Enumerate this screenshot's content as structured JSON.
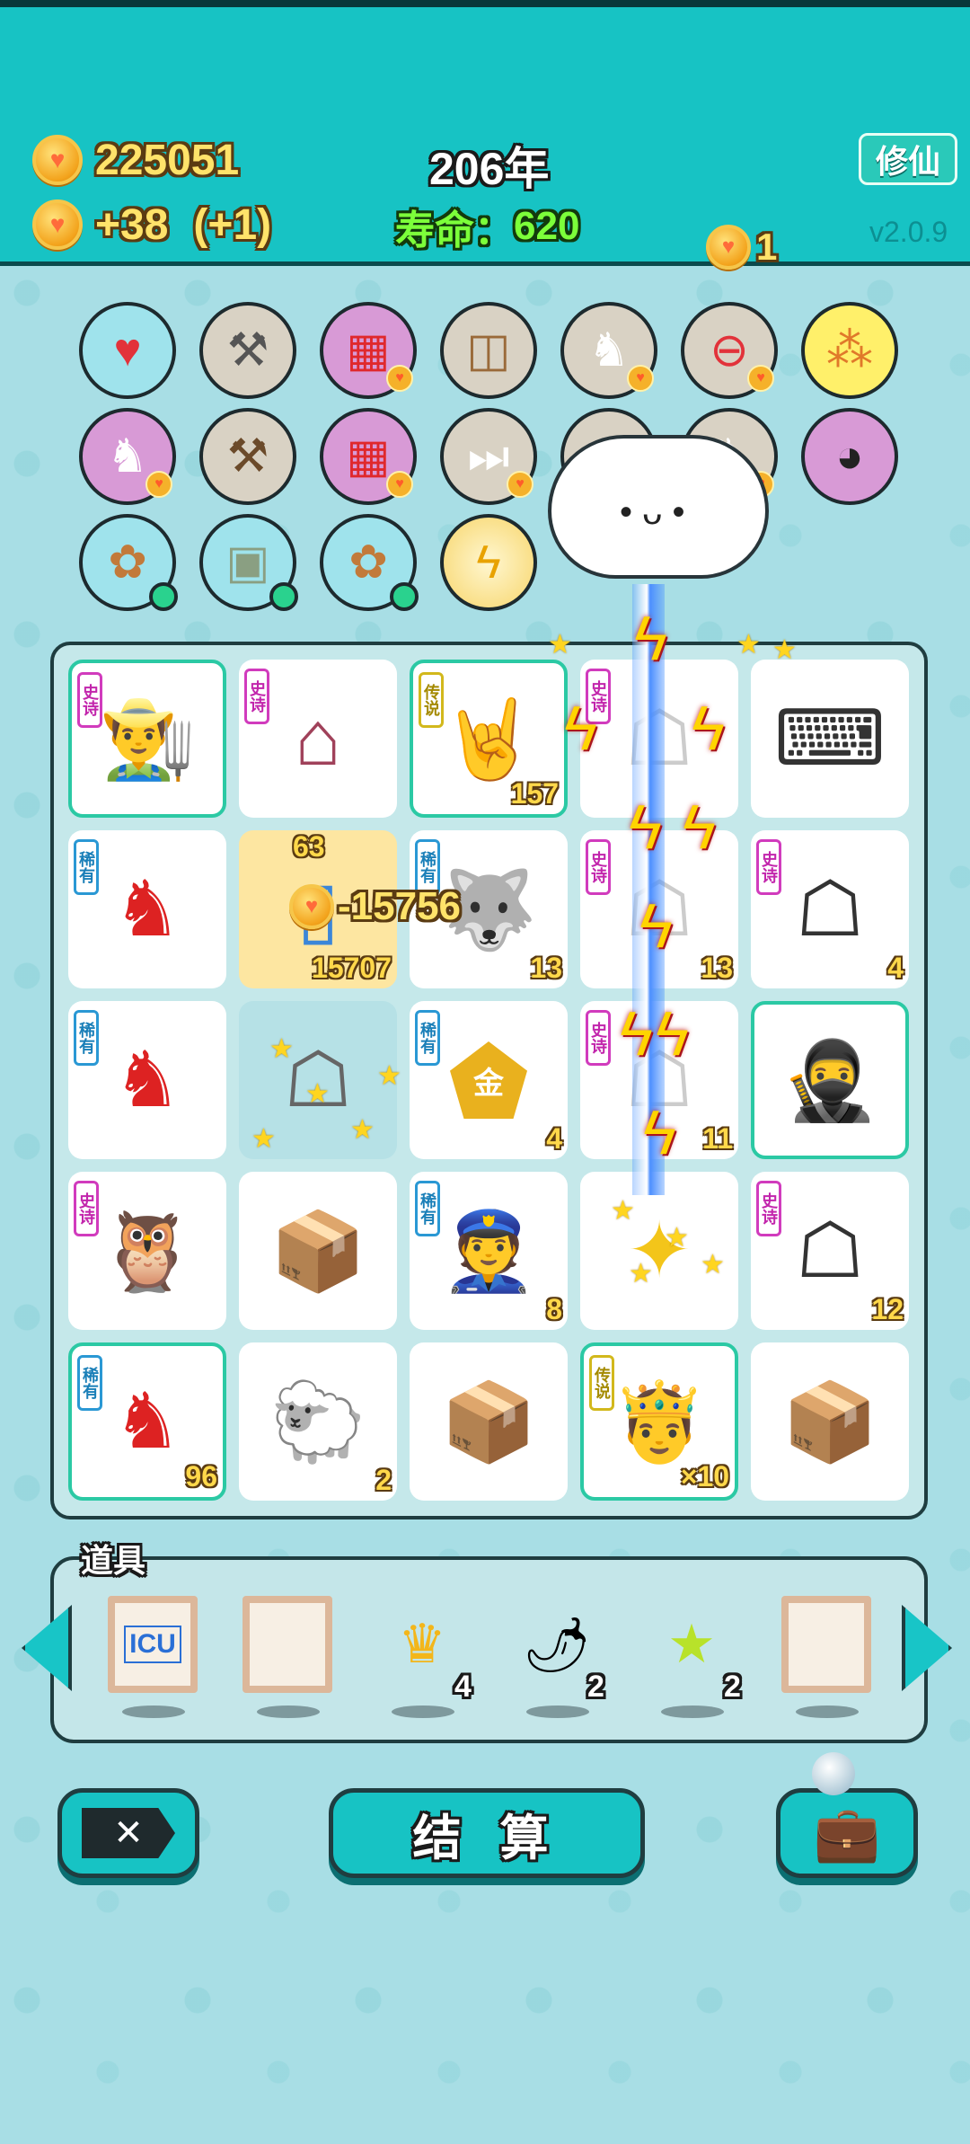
{
  "header": {
    "coins": "225051",
    "income": "+38",
    "income_bonus": "(+1)",
    "year": "206年",
    "lifespan_label": "寿命：",
    "lifespan_value": "620",
    "xiuxian_button": "修仙",
    "version": "v2.0.9",
    "coin_popup": "1"
  },
  "relics": [
    {
      "icon": "heart-bag-icon"
    },
    {
      "icon": "screwdriver-icon"
    },
    {
      "icon": "fries-icon"
    },
    {
      "icon": "dog-food-icon"
    },
    {
      "icon": "bunny-icon"
    },
    {
      "icon": "minus-icon"
    },
    {
      "icon": "basketballs-icon"
    },
    {
      "icon": "bunny-icon"
    },
    {
      "icon": "hammer-icon"
    },
    {
      "icon": "fries-icon"
    },
    {
      "icon": "skip-icon"
    },
    {
      "icon": "chick-icon"
    },
    {
      "icon": "bunny-icon"
    },
    {
      "icon": "panda-icon"
    },
    {
      "icon": "flower-pot-icon"
    },
    {
      "icon": "money-bag-icon"
    },
    {
      "icon": "flower-pot-icon"
    },
    {
      "icon": "lightning-icon"
    }
  ],
  "board": {
    "cells": [
      {
        "tag": "史诗",
        "icon": "farmer-icon",
        "count": ""
      },
      {
        "tag": "史诗",
        "icon": "bunny-house-icon",
        "count": ""
      },
      {
        "tag": "传说",
        "icon": "rock-hand-icon",
        "count": "157"
      },
      {
        "tag": "史诗",
        "icon": "ghost-icon",
        "count": ""
      },
      {
        "tag": "",
        "icon": "keyboard-icon",
        "count": ""
      },
      {
        "tag": "稀有",
        "icon": "bunny-icon",
        "count": ""
      },
      {
        "tag": "",
        "icon": "fridge-icon",
        "count": "15707"
      },
      {
        "tag": "稀有",
        "icon": "husky-icon",
        "count": "13"
      },
      {
        "tag": "史诗",
        "icon": "ghost-icon",
        "count": "13"
      },
      {
        "tag": "史诗",
        "icon": "ghost-icon",
        "count": "4"
      },
      {
        "tag": "稀有",
        "icon": "bunny-icon",
        "count": ""
      },
      {
        "tag": "",
        "icon": "ghost-icon",
        "count": ""
      },
      {
        "tag": "稀有",
        "icon": "gold-badge-icon",
        "count": "4"
      },
      {
        "tag": "史诗",
        "icon": "ghost-icon",
        "count": "11"
      },
      {
        "tag": "",
        "icon": "thief-icon",
        "count": ""
      },
      {
        "tag": "史诗",
        "icon": "owl-icon",
        "count": ""
      },
      {
        "tag": "",
        "icon": "box-icon",
        "count": ""
      },
      {
        "tag": "稀有",
        "icon": "police-icon",
        "count": "8"
      },
      {
        "tag": "",
        "icon": "stars-icon",
        "count": ""
      },
      {
        "tag": "史诗",
        "icon": "ghost-icon",
        "count": "12"
      },
      {
        "tag": "稀有",
        "icon": "bunny-icon",
        "count": "96"
      },
      {
        "tag": "",
        "icon": "sheep-icon",
        "count": "2"
      },
      {
        "tag": "",
        "icon": "box-icon",
        "count": ""
      },
      {
        "tag": "传说",
        "icon": "king-icon",
        "count": "×10"
      },
      {
        "tag": "",
        "icon": "box-icon",
        "count": ""
      }
    ],
    "gold_badge_text": "金",
    "fridge_top_count": "63",
    "floater_value": "-15756"
  },
  "items": {
    "label": "道具",
    "slots": [
      {
        "icon": "icu-icon",
        "text": "ICU",
        "count": ""
      },
      {
        "icon": "blank-frame-icon",
        "text": "",
        "count": ""
      },
      {
        "icon": "crown-icon",
        "text": "",
        "count": "4"
      },
      {
        "icon": "chili-icon",
        "text": "",
        "count": "2"
      },
      {
        "icon": "star-icon",
        "text": "",
        "count": "2"
      },
      {
        "icon": "blank-frame-icon",
        "text": "",
        "count": ""
      }
    ]
  },
  "actions": {
    "settle_label": "结 算"
  },
  "colors": {
    "header_bg": "#17c3c4",
    "page_bg": "#a6dde4",
    "gold": "#ffe36a",
    "green": "#7cff3a"
  }
}
